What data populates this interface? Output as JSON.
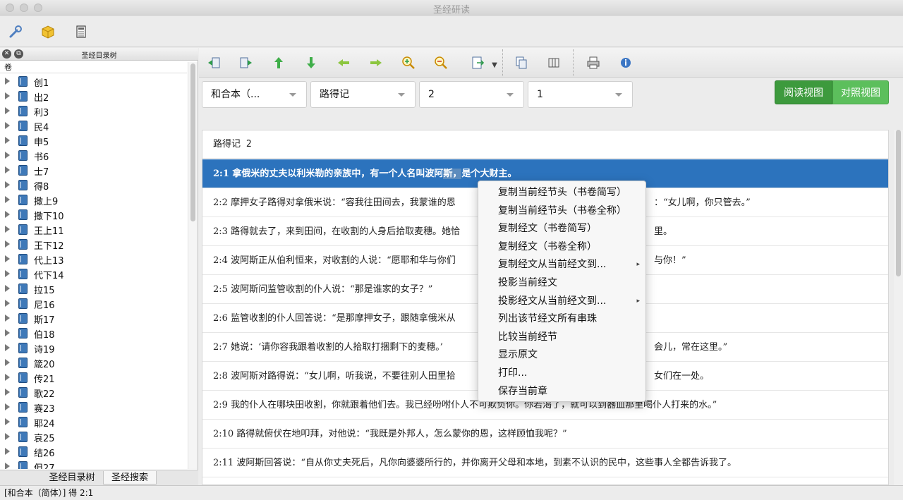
{
  "window": {
    "title": "圣经研读"
  },
  "left_pane": {
    "title": "圣经目录树",
    "column_header": "卷",
    "books": [
      "创1",
      "出2",
      "利3",
      "民4",
      "申5",
      "书6",
      "士7",
      "得8",
      "撒上9",
      "撒下10",
      "王上11",
      "王下12",
      "代上13",
      "代下14",
      "拉15",
      "尼16",
      "斯17",
      "伯18",
      "诗19",
      "箴20",
      "传21",
      "歌22",
      "赛23",
      "耶24",
      "哀25",
      "结26",
      "但27"
    ],
    "tabs": [
      {
        "label": "圣经目录树",
        "active": false
      },
      {
        "label": "圣经搜索",
        "active": true
      }
    ]
  },
  "selectors": {
    "version": "和合本（...",
    "book": "路得记",
    "chapter": "2",
    "verse": "1"
  },
  "view_buttons": {
    "reading": "阅读视图",
    "compare": "对照视图"
  },
  "chapter_title": "路得记 2",
  "verses": [
    {
      "ref": "2:1",
      "text_a": "拿俄米的丈夫以利米勒的亲族中，有一个人名叫波阿",
      "text_hl": "斯，",
      "text_b": "是个大财主。",
      "selected": true
    },
    {
      "ref": "2:2",
      "text": "摩押女子路得对拿俄米说：“容我往田间去，我蒙谁的恩",
      "tail": "：“女儿啊，你只管去。”"
    },
    {
      "ref": "2:3",
      "text": "路得就去了，来到田间，在收割的人身后拾取麦穗。她恰",
      "tail": "里。"
    },
    {
      "ref": "2:4",
      "text": "波阿斯正从伯利恒来，对收割的人说：“愿耶和华与你们",
      "tail": "与你！”"
    },
    {
      "ref": "2:5",
      "text": "波阿斯问监管收割的仆人说：“那是谁家的女子？”",
      "tail": ""
    },
    {
      "ref": "2:6",
      "text": "监管收割的仆人回答说：“是那摩押女子，跟随拿俄米从",
      "tail": ""
    },
    {
      "ref": "2:7",
      "text": "她说：‘请你容我跟着收割的人拾取打捆剩下的麦穗。’",
      "tail": "会儿，常在这里。”"
    },
    {
      "ref": "2:8",
      "text": "波阿斯对路得说：“女儿啊，听我说，不要往别人田里拾",
      "tail": "女们在一处。"
    },
    {
      "ref": "2:9",
      "text": "我的仆人在哪块田收割，你就跟着他们去。我已经吩咐仆人不可欺负你。你若渴了，就可以到器皿那里喝仆人打来的水。”",
      "tail": ""
    },
    {
      "ref": "2:10",
      "text": "路得就俯伏在地叩拜，对他说：“我既是外邦人，怎么蒙你的恩，这样顾恤我呢？”",
      "tail": ""
    },
    {
      "ref": "2:11",
      "text": "波阿斯回答说：“自从你丈夫死后，凡你向婆婆所行的，并你离开父母和本地，到素不认识的民中，这些事人全都告诉我了。",
      "tail": ""
    }
  ],
  "context_menu": [
    {
      "label": "复制当前经节头（书卷简写）",
      "submenu": false
    },
    {
      "label": "复制当前经节头（书卷全称）",
      "submenu": false
    },
    {
      "label": "复制经文（书卷简写）",
      "submenu": false
    },
    {
      "label": "复制经文（书卷全称）",
      "submenu": false
    },
    {
      "label": "复制经文从当前经文到...",
      "submenu": true
    },
    {
      "label": "投影当前经文",
      "submenu": false
    },
    {
      "label": "投影经文从当前经文到...",
      "submenu": true
    },
    {
      "label": "列出该节经文所有串珠",
      "submenu": false
    },
    {
      "label": "比较当前经节",
      "submenu": false
    },
    {
      "label": "显示原文",
      "submenu": false
    },
    {
      "label": "打印...",
      "submenu": false
    },
    {
      "label": "保存当前章",
      "submenu": false
    }
  ],
  "submenu_glyph": "▸",
  "status": "[和合本（简体）] 得 2:1",
  "colors": {
    "selection": "#2c73bd",
    "view_active": "#3d9a3d",
    "view_inactive": "#5cbf5c"
  }
}
